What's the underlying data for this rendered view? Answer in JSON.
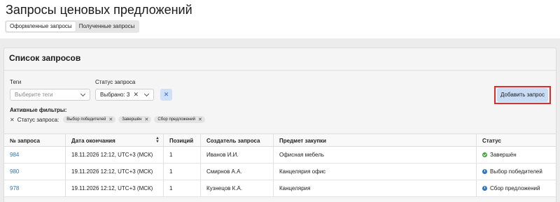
{
  "page": {
    "title": "Запросы ценовых предложений"
  },
  "tabs": [
    {
      "label": "Оформленные запросы",
      "active": true
    },
    {
      "label": "Полученные запросы",
      "active": false
    }
  ],
  "card": {
    "title": "Список запросов"
  },
  "filters": {
    "tags": {
      "label": "Теги",
      "placeholder": "Выберите теги"
    },
    "status": {
      "label": "Статус запроса",
      "value": "Выбрано: 3"
    },
    "clear_icon": "close-icon"
  },
  "add_button": {
    "label": "Добавить запрос"
  },
  "active_filters": {
    "title": "Активные фильтры:",
    "label": "Статус запроса:",
    "chips": [
      "Выбор победителей",
      "Завершён",
      "Сбор предложений"
    ]
  },
  "table": {
    "columns": [
      "№ запроса",
      "Дата окончания",
      "Позиций",
      "Создатель запроса",
      "Предмет закупки",
      "Статус"
    ],
    "rows": [
      {
        "number": "984",
        "date": "18.11.2026 12:12, UTC+3 (МСК)",
        "positions": "1",
        "creator": "Иванов И.И.",
        "subject": "Офисная мебель",
        "status": "Завершён",
        "status_icon": "check-circle-icon",
        "status_color": "#3aa835"
      },
      {
        "number": "980",
        "date": "19.11.2026 12:12, UTC+3 (МСК)",
        "positions": "1",
        "creator": "Смирнов А.А.",
        "subject": "Канцелярия офис",
        "status": "Выбор победителей",
        "status_icon": "clock-icon",
        "status_color": "#2a78c7"
      },
      {
        "number": "978",
        "date": "19.11.2026 12:12, UTC+3 (МСК)",
        "positions": "1",
        "creator": "Кузнецов К.А.",
        "subject": "Канцелярия",
        "status": "Сбор предложений",
        "status_icon": "clock-icon",
        "status_color": "#2a78c7"
      }
    ]
  },
  "colors": {
    "accent": "#2b74c9",
    "highlight_border": "#e02b2b",
    "button_bg": "#c9dcf5"
  }
}
